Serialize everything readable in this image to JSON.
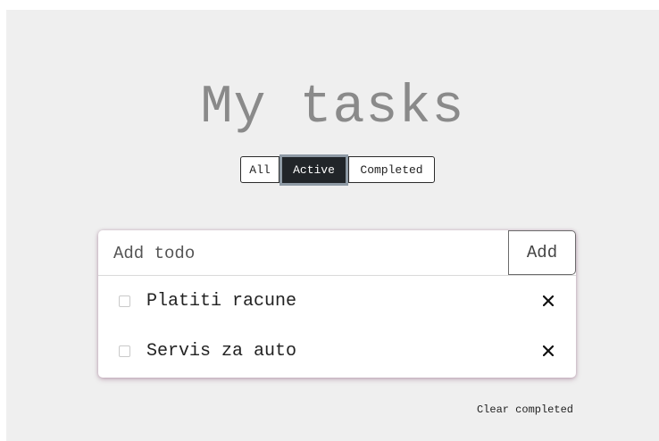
{
  "header": {
    "title": "My tasks"
  },
  "filters": {
    "items": [
      {
        "label": "All",
        "selected": false
      },
      {
        "label": "Active",
        "selected": true
      },
      {
        "label": "Completed",
        "selected": false
      }
    ]
  },
  "todo_form": {
    "input_value": "",
    "input_placeholder": "Add todo",
    "add_label": "Add"
  },
  "todos": [
    {
      "text": "Platiti racune",
      "completed": false,
      "delete_glyph": "✕"
    },
    {
      "text": "Servis za auto",
      "completed": false,
      "delete_glyph": "✕"
    }
  ],
  "footer": {
    "clear_label": "Clear completed"
  },
  "colors": {
    "page_bg": "#efefef",
    "title": "#8a8a8a",
    "active_filter_bg": "#212529",
    "active_filter_border": "#8e9aa5"
  },
  "icons": {
    "delete": "close-icon",
    "checkbox": "checkbox-icon"
  }
}
